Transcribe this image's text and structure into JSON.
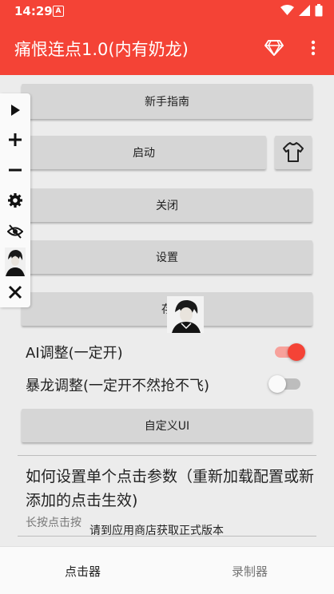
{
  "status_bar": {
    "time": "14:29",
    "notification_glyph": "A"
  },
  "app_bar": {
    "title": "痛恨连点1.0(内有奶龙)",
    "icons": [
      "diamond-icon",
      "more-vert-icon"
    ]
  },
  "buttons": {
    "guide": "新手指南",
    "start": "启动",
    "close": "关闭",
    "settings": "设置",
    "save": "存",
    "custom_ui": "自定义UI"
  },
  "floating_toolbar": [
    "play-icon",
    "plus-icon",
    "minus-icon",
    "gear-icon",
    "eye-off-icon",
    "avatar",
    "close-icon"
  ],
  "toggles": [
    {
      "label": "AI调整(一定开)",
      "on": true
    },
    {
      "label": "暴龙调整(一定开不然抢不飞)",
      "on": false
    }
  ],
  "help": {
    "title": "如何设置单个点击参数（重新加载配置或新添加的点击生效)",
    "subtitle": "长按点击按",
    "toast": "请到应用商店获取正式版本"
  },
  "bottom_nav": {
    "tabs": [
      "点击器",
      "录制器"
    ],
    "selected": 0
  },
  "colors": {
    "primary": "#f44336",
    "accent": "#f44336",
    "button": "#d6d6d6"
  }
}
